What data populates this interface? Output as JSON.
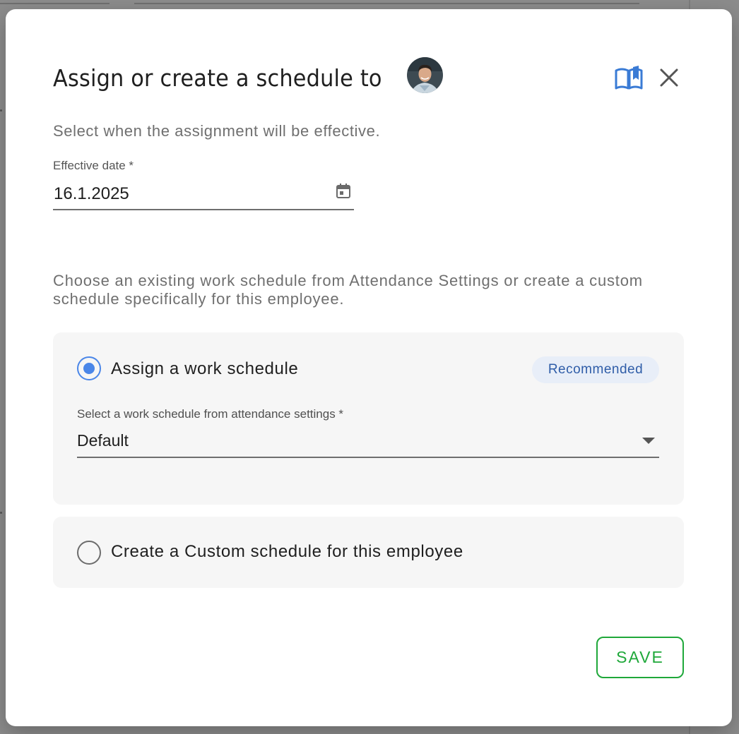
{
  "dialog": {
    "title": "Assign or create a schedule to",
    "subtitle": "Select when the assignment will be effective.",
    "effective_date": {
      "label": "Effective date *",
      "value": "16.1.2025"
    },
    "description": "Choose an existing work schedule from Attendance Settings or create a custom schedule specifically for this employee.",
    "options": [
      {
        "label": "Assign a work schedule",
        "checked": true,
        "badge": "Recommended",
        "select": {
          "label": "Select a work schedule from attendance settings *",
          "value": "Default"
        }
      },
      {
        "label": "Create a Custom schedule for this employee",
        "checked": false
      }
    ],
    "save_label": "SAVE",
    "icons": {
      "help": "book-open-icon",
      "close": "close-icon",
      "calendar": "calendar-icon",
      "dropdown": "caret-down-icon"
    },
    "colors": {
      "accent_blue": "#4a86e8",
      "save_green": "#1fa83a",
      "badge_bg": "#e8eef8",
      "badge_text": "#2f5da8"
    }
  }
}
